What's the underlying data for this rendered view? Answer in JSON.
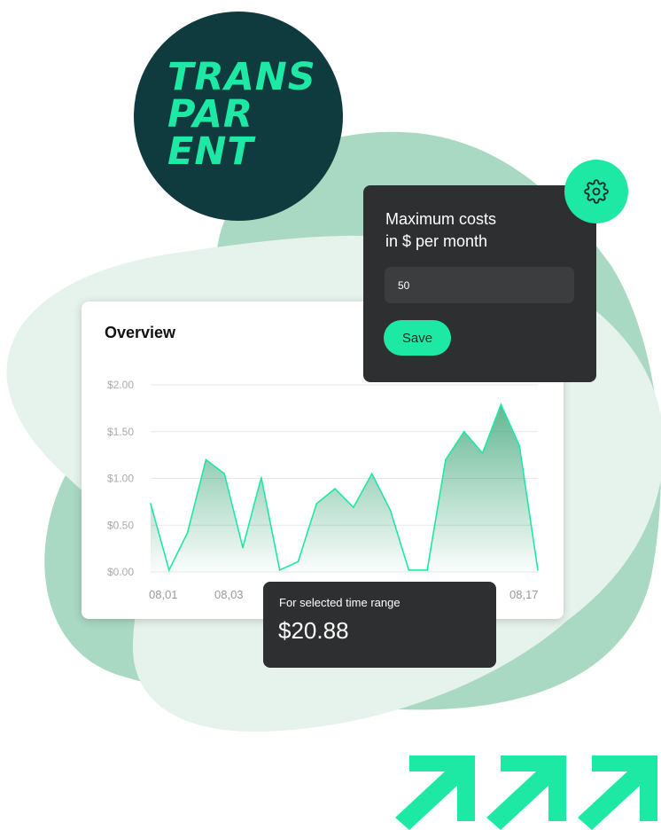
{
  "badge": {
    "lines": [
      "TRANS",
      "PAR",
      "ENT"
    ]
  },
  "colors": {
    "accent": "#1ee9a4",
    "badge_bg": "#0f3b3e",
    "panel_bg": "#2e2f30",
    "blob_light": "#e6f2ec",
    "blob_mid": "#a9d8c3"
  },
  "settings": {
    "title_lines": [
      "Maximum costs",
      "in $ per month"
    ],
    "input_value": "50",
    "save_label": "Save",
    "icon": "gear-icon"
  },
  "overview": {
    "title": "Overview"
  },
  "chart_data": {
    "type": "area",
    "title": "Overview",
    "xlabel": "",
    "ylabel": "",
    "ylim": [
      0,
      2
    ],
    "y_ticks": [
      "$0.00",
      "$0.50",
      "$1.00",
      "$1.50",
      "$2.00"
    ],
    "y_tick_values": [
      0,
      0.5,
      1,
      1.5,
      2
    ],
    "x_tick_labels": [
      {
        "label": "08,01",
        "index": 0
      },
      {
        "label": "08,03",
        "index": 4
      },
      {
        "label": "08,17",
        "index": 29
      }
    ],
    "grid": true,
    "values": [
      0.73,
      0.02,
      0.42,
      1.2,
      1.05,
      0.26,
      1.01,
      0.02,
      0.11,
      0.73,
      0.89,
      0.69,
      1.05,
      0.66,
      0.02,
      0.02,
      1.2,
      1.5,
      1.27,
      1.79,
      1.35,
      0.02
    ]
  },
  "total": {
    "label": "For selected time range",
    "value": "$20.88"
  },
  "arrows": {
    "icon": "arrow-up-right-icon",
    "count": 3
  }
}
